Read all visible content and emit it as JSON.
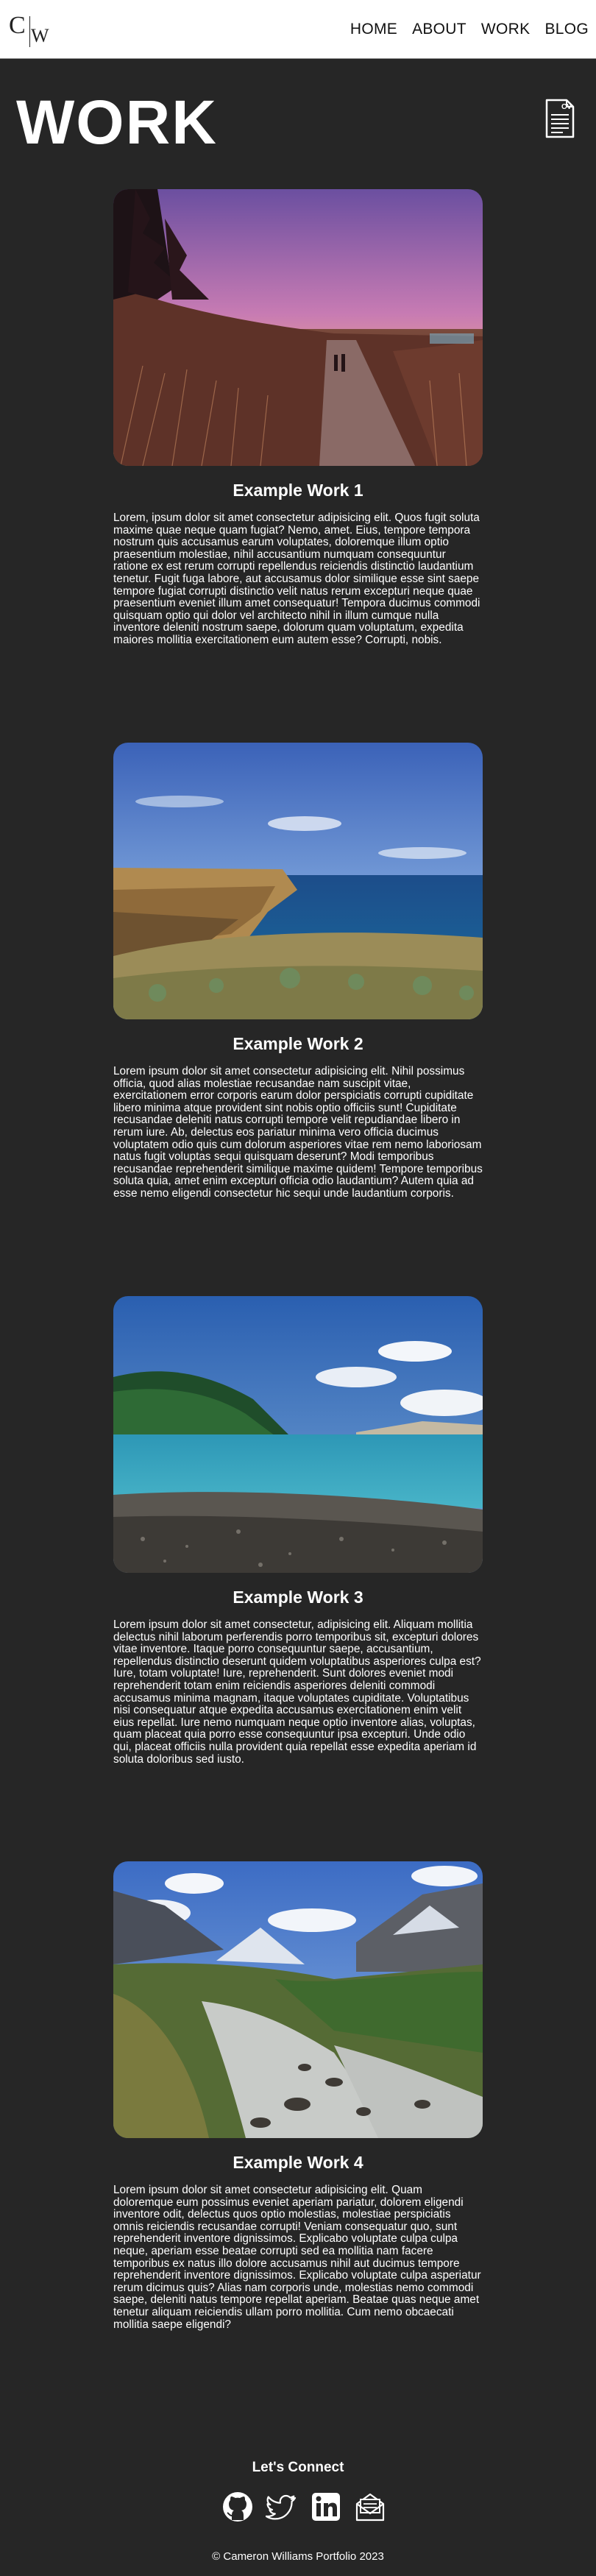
{
  "logo": {
    "letter1": "C",
    "letter2": "W"
  },
  "nav": {
    "items": [
      "HOME",
      "ABOUT",
      "WORK",
      "BLOG"
    ]
  },
  "page": {
    "title": "WORK",
    "cv_icon_label": "CV"
  },
  "works": [
    {
      "title": "Example Work 1",
      "image_icon": "sunset-path-photo",
      "text": "Lorem, ipsum dolor sit amet consectetur adipisicing elit. Quos fugit soluta maxime quae neque quam fugiat? Nemo, amet. Eius, tempore tempora nostrum quis accusamus earum voluptates, doloremque illum optio praesentium molestiae, nihil accusantium numquam consequuntur ratione ex est rerum corrupti repellendus reiciendis distinctio laudantium tenetur. Fugit fuga labore, aut accusamus dolor similique esse sint saepe tempore fugiat corrupti distinctio velit natus rerum excepturi neque quae praesentium eveniet illum amet consequatur! Tempora ducimus commodi quisquam optio qui dolor vel architecto nihil in illum cumque nulla inventore deleniti nostrum saepe, dolorum quam voluptatum, expedita maiores mollitia exercitationem eum autem esse? Corrupti, nobis."
    },
    {
      "title": "Example Work 2",
      "image_icon": "coastal-cliffs-photo",
      "text": "Lorem ipsum dolor sit amet consectetur adipisicing elit. Nihil possimus officia, quod alias molestiae recusandae nam suscipit vitae, exercitationem error corporis earum dolor perspiciatis corrupti cupiditate libero minima atque provident sint nobis optio officiis sunt! Cupiditate recusandae deleniti natus corrupti tempore velit repudiandae libero in rerum iure. Ab, delectus eos pariatur minima vero officia ducimus voluptatem odio quis cum dolorum asperiores vitae rem nemo laboriosam natus fugit voluptas sequi quisquam deserunt? Modi temporibus recusandae reprehenderit similique maxime quidem! Tempore temporibus soluta quia, amet enim excepturi officia odio laudantium? Autem quia ad esse nemo eligendi consectetur hic sequi unde laudantium corporis."
    },
    {
      "title": "Example Work 3",
      "image_icon": "lake-hills-photo",
      "text": "Lorem ipsum dolor sit amet consectetur, adipisicing elit. Aliquam mollitia delectus nihil laborum perferendis porro temporibus sit, excepturi dolores vitae inventore. Itaque porro consequuntur saepe, accusantium, repellendus distinctio deserunt quidem voluptatibus asperiores culpa est? Iure, totam voluptate! Iure, reprehenderit. Sunt dolores eveniet modi reprehenderit totam enim reiciendis asperiores deleniti commodi accusamus minima magnam, itaque voluptates cupiditate. Voluptatibus nisi consequatur atque expedita accusamus exercitationem enim velit eius repellat. Iure nemo numquam neque optio inventore alias, voluptas, quam placeat quia porro esse consequuntur ipsa excepturi. Unde odio qui, placeat officiis nulla provident quia repellat esse expedita aperiam id soluta doloribus sed iusto."
    },
    {
      "title": "Example Work 4",
      "image_icon": "mountain-river-photo",
      "text": "Lorem ipsum dolor sit amet consectetur adipisicing elit. Quam doloremque eum possimus eveniet aperiam pariatur, dolorem eligendi inventore odit, delectus quos optio molestias, molestiae perspiciatis omnis reiciendis recusandae corrupti! Veniam consequatur quo, sunt reprehenderit inventore dignissimos. Explicabo voluptate culpa culpa neque, aperiam esse beatae corrupti sed ea mollitia nam facere temporibus ex natus illo dolore accusamus nihil aut ducimus tempore reprehenderit inventore dignissimos. Explicabo voluptate culpa asperiatur rerum dicimus quis? Alias nam corporis unde, molestias nemo commodi saepe, deleniti natus tempore repellat aperiam. Beatae quas neque amet tenetur aliquam reiciendis ullam porro mollitia. Cum nemo obcaecati mollitia saepe eligendi?"
    }
  ],
  "footer": {
    "title": "Let's Connect",
    "social_icons": [
      "github-icon",
      "twitter-icon",
      "linkedin-icon",
      "email-icon"
    ],
    "copyright": "© Cameron Williams Portfolio 2023"
  }
}
